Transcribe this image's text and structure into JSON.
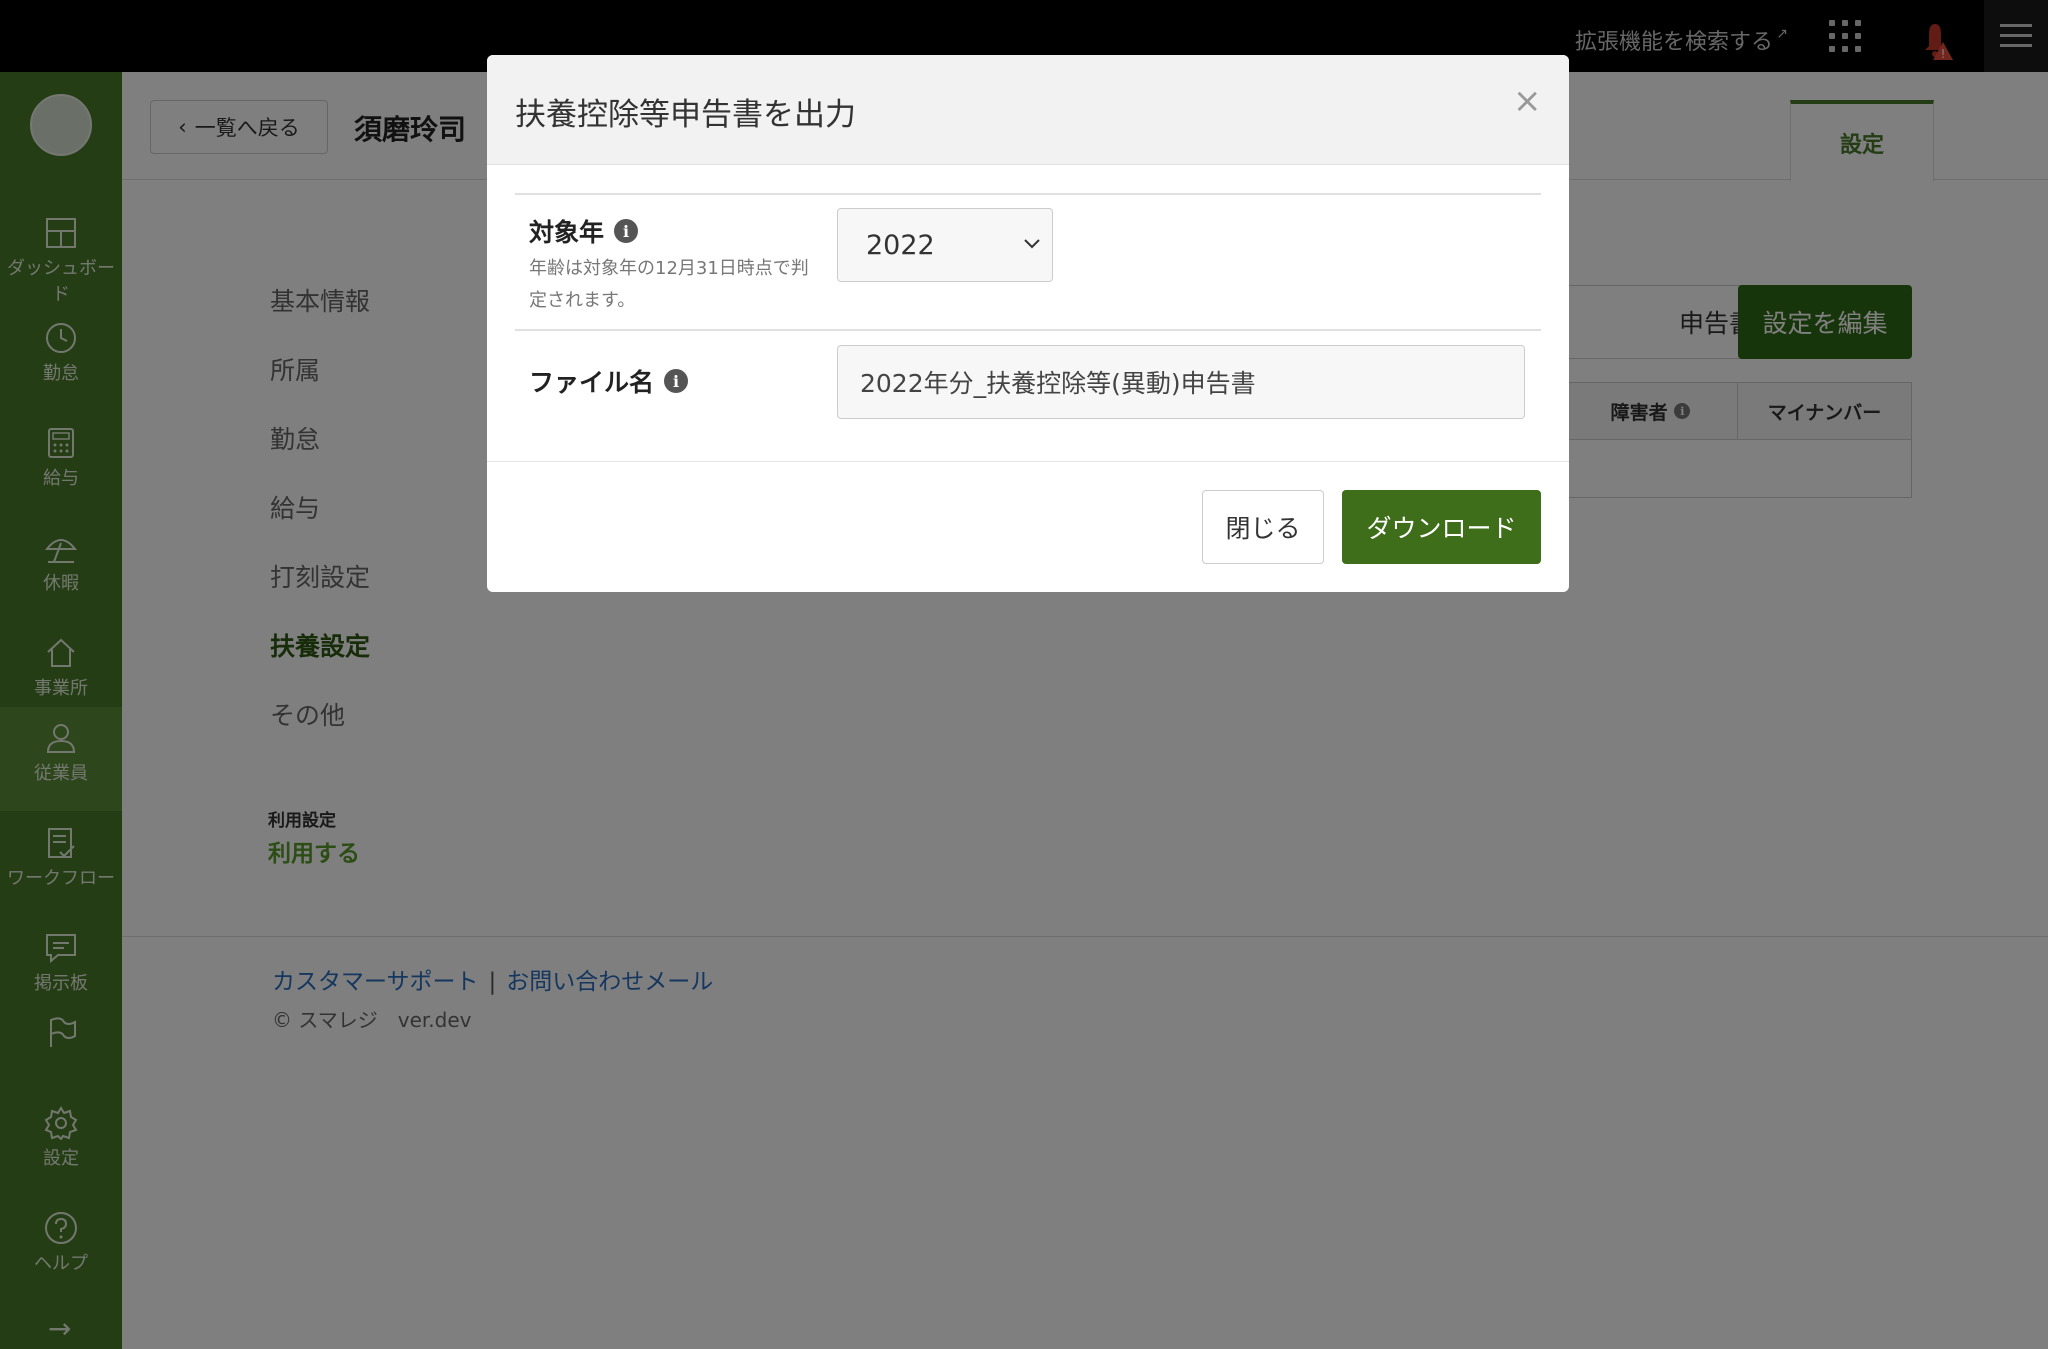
{
  "topbar": {
    "extension_link": "拡張機能を検索する",
    "external_icon": "external-link-icon",
    "apps_icon": "grid-icon",
    "bell_icon": "bell-alert-icon",
    "menu_icon": "hamburger-icon"
  },
  "sidebar": {
    "items": [
      {
        "label": "ダッシュボード",
        "icon": "dashboard-icon"
      },
      {
        "label": "勤怠",
        "icon": "clock-icon"
      },
      {
        "label": "給与",
        "icon": "calculator-icon"
      },
      {
        "label": "休暇",
        "icon": "umbrella-icon"
      },
      {
        "label": "事業所",
        "icon": "home-icon"
      },
      {
        "label": "従業員",
        "icon": "person-icon"
      },
      {
        "label": "ワークフロー",
        "icon": "checklist-icon"
      },
      {
        "label": "掲示板",
        "icon": "chat-icon"
      },
      {
        "label": "",
        "icon": "flag-icon"
      },
      {
        "label": "設定",
        "icon": "gear-icon"
      },
      {
        "label": "ヘルプ",
        "icon": "help-icon"
      }
    ],
    "active_index": 5,
    "expand_icon": "arrow-right-icon"
  },
  "header": {
    "back_label": "一覧へ戻る",
    "employee_name": "須磨玲司",
    "settings_tab": "設定"
  },
  "section_nav": [
    "基本情報",
    "所属",
    "勤怠",
    "給与",
    "打刻設定",
    "扶養設定",
    "その他"
  ],
  "usage": {
    "label": "利用設定",
    "value": "利用する"
  },
  "actions": {
    "export_label": "申告書を出力",
    "edit_label": "設定を編集"
  },
  "table": {
    "headers": [
      "障害者",
      "マイナンバー"
    ]
  },
  "footer": {
    "support_link": "カスタマーサポート",
    "separator": "|",
    "mail_link": "お問い合わせメール",
    "copyright": "© スマレジ　ver.dev"
  },
  "modal": {
    "title": "扶養控除等申告書を出力",
    "close_symbol": "×",
    "year_label": "対象年",
    "year_hint": "年齢は対象年の12月31日時点で判定されます。",
    "year_value": "2022",
    "filename_label": "ファイル名",
    "filename_value": "2022年分_扶養控除等(異動)申告書",
    "close_button": "閉じる",
    "download_button": "ダウンロード",
    "info_symbol": "i"
  },
  "colors": {
    "brand_green": "#4a7a2a",
    "button_green": "#3f6e1a",
    "link_blue": "#2a6fbf",
    "usage_green": "#5b9b2f"
  }
}
